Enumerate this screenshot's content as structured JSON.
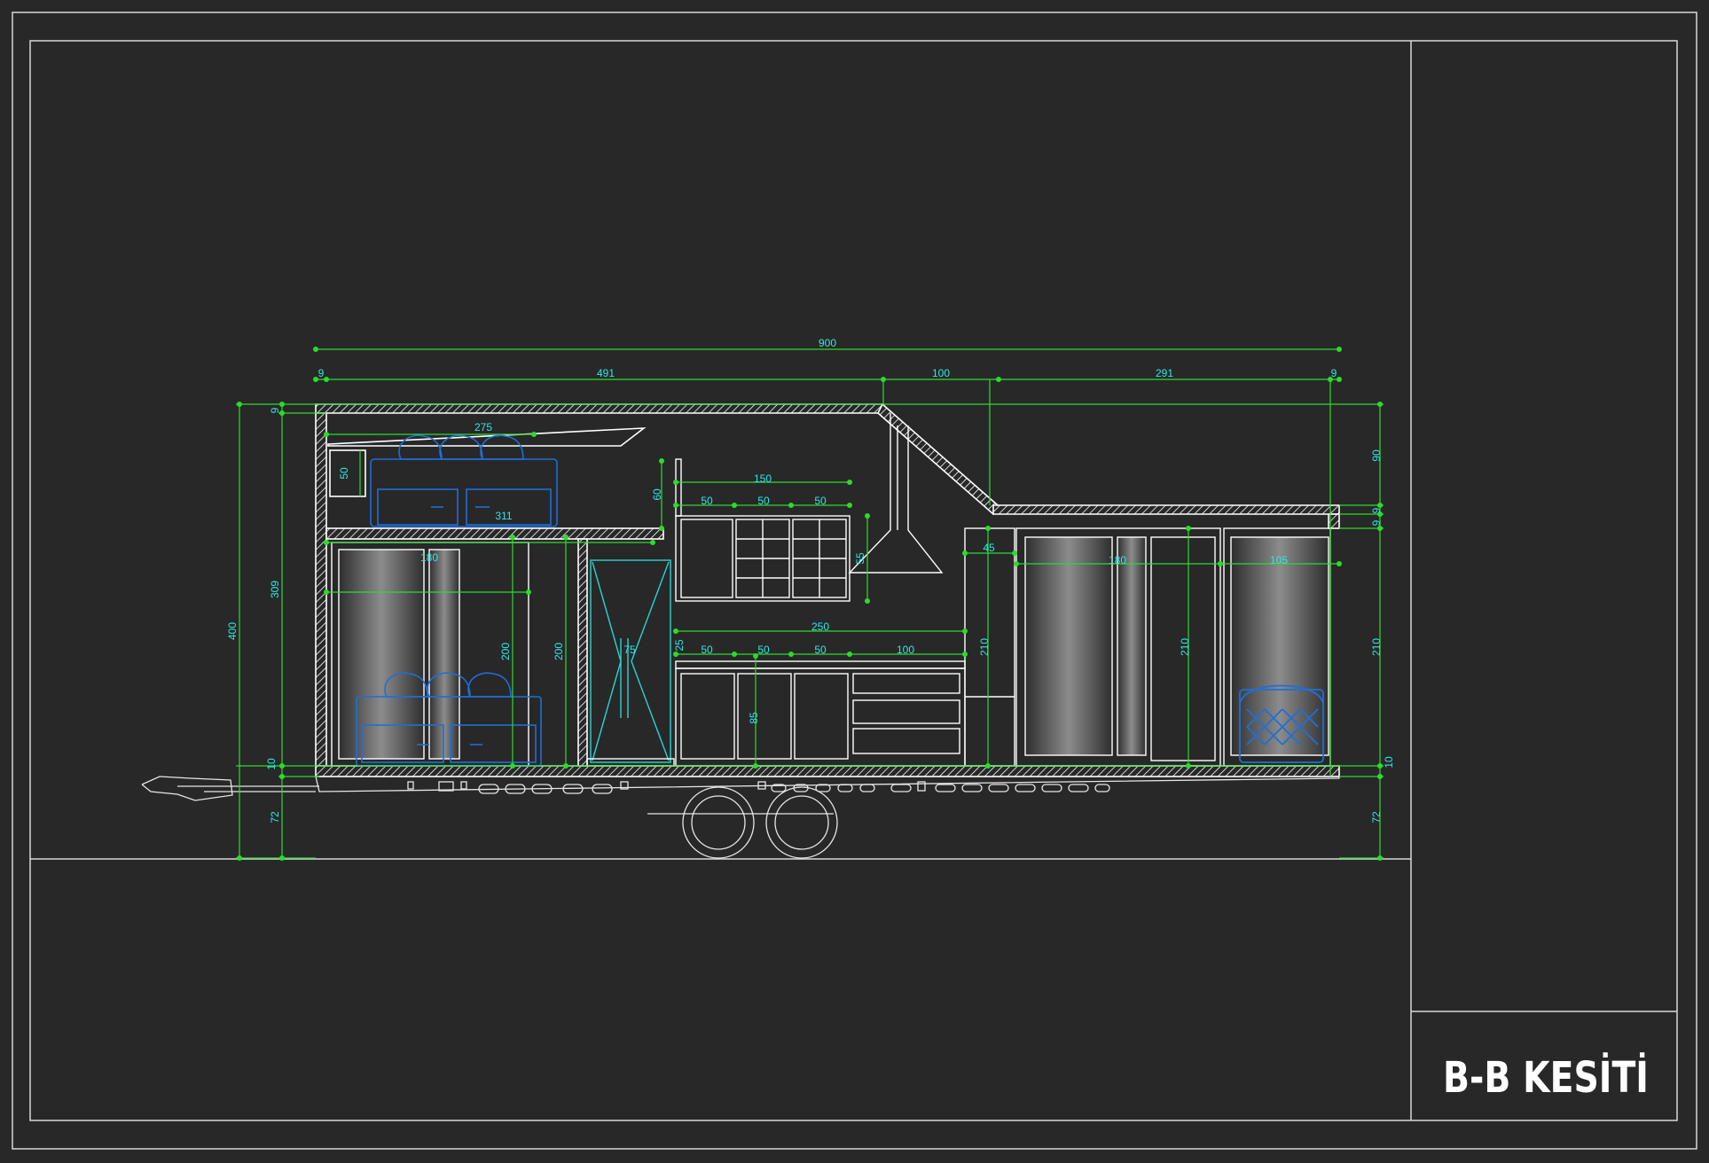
{
  "sheet": {
    "title": "B-B KESİTİ",
    "colors": {
      "background": "#282828",
      "frame": "#d8d8d8",
      "structure": "#ffffff",
      "dimension": "#2bdc2b",
      "dimension_text": "#2ee8e8",
      "furniture": "#1e6fd9",
      "glass": "#2ad4d4"
    }
  },
  "dimensions": {
    "overall_length": "900",
    "front_section": "491",
    "roof_slope": "100",
    "rear_section": "291",
    "left_offset": "9",
    "right_offset": "9",
    "loft_bed": "275",
    "loft_shelf": "50",
    "loft_floor": "311",
    "total_height": "400",
    "inner_height": "309",
    "chassis_left": "72",
    "floor_left": "10",
    "top_left": "9",
    "living_window": "180",
    "living_height": "200",
    "stair_height": "200",
    "fridge_width": "75",
    "upper_cab_total": "150",
    "upper_cab_1": "50",
    "upper_cab_2": "50",
    "upper_cab_3": "50",
    "upper_cab_height": "60",
    "upper_cab_depth": "55",
    "counter_total": "250",
    "lower_cab_1": "50",
    "lower_cab_2": "50",
    "lower_cab_3": "50",
    "drawer_unit": "100",
    "counter_height": "85",
    "counter_gap": "25",
    "tall_cab_width": "45",
    "tall_cab_height": "210",
    "wardrobe_width": "180",
    "wardrobe_height": "210",
    "bath_width": "105",
    "rear_height": "210",
    "rear_roof": "90",
    "rear_small_1": "9",
    "rear_small_2": "9",
    "rear_floor": "10",
    "rear_chassis": "72"
  }
}
